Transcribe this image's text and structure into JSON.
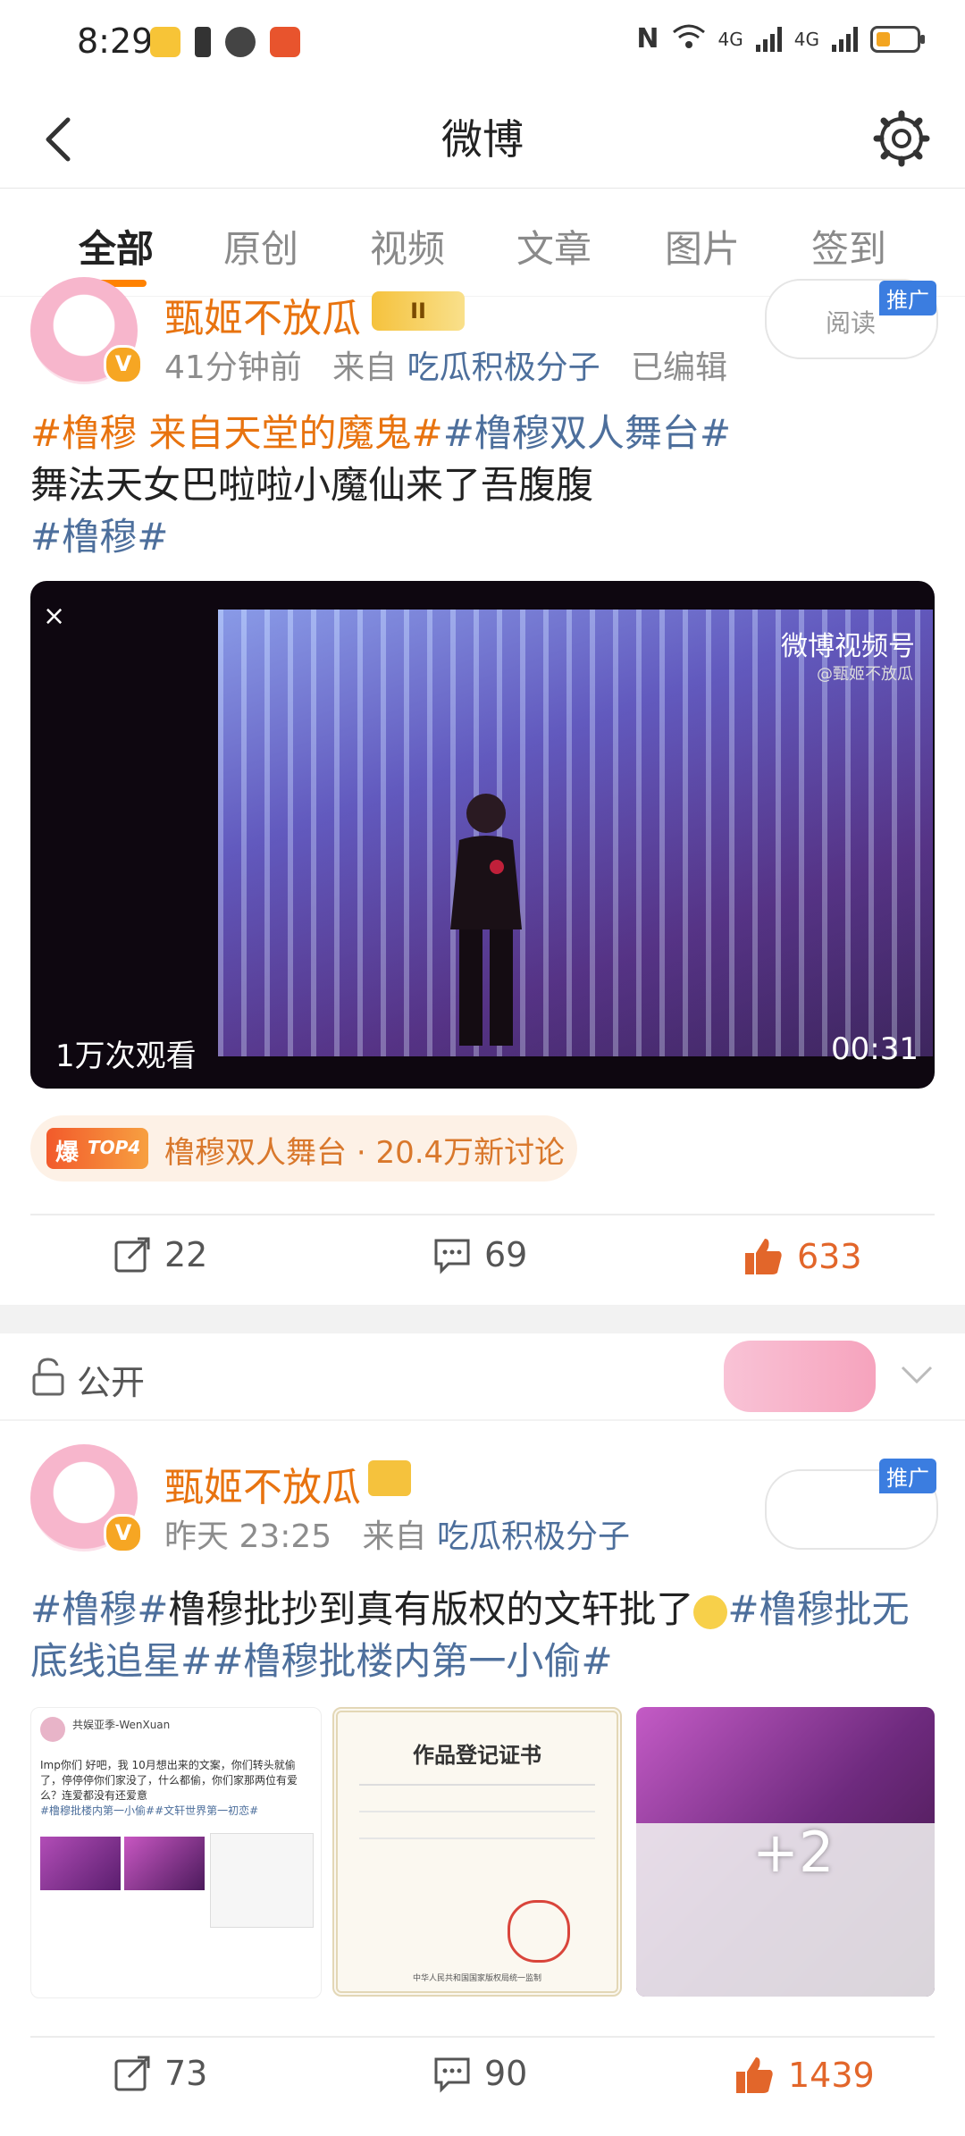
{
  "status_bar": {
    "time": "8:29",
    "network1": "4G",
    "network2": "4G",
    "battery_level": 0.35
  },
  "header": {
    "title": "微博"
  },
  "tabs": [
    {
      "label": "全部",
      "active": true
    },
    {
      "label": "原创"
    },
    {
      "label": "视频"
    },
    {
      "label": "文章"
    },
    {
      "label": "图片"
    },
    {
      "label": "签到"
    }
  ],
  "post1": {
    "username": "甄姬不放瓜",
    "level": "II",
    "time": "41分钟前",
    "from_prefix": "来自",
    "source": "吃瓜积极分子",
    "edited": "已编辑",
    "read_label": "阅读",
    "ad_label": "推广",
    "text_tag1": "#橹穆 来自天堂的魔鬼#",
    "text_tag2": "#橹穆双人舞台#",
    "text_body": "舞法天女巴啦啦小魔仙来了吾腹腹",
    "text_tag3": "#橹穆#",
    "video": {
      "close": "×",
      "watermark": "微博视频号",
      "watermark_sub": "@甄姬不放瓜",
      "views": "1万次观看",
      "duration": "00:31"
    },
    "topic": {
      "badge_main": "爆",
      "badge_rank": "TOP4",
      "name": "橹穆双人舞台",
      "separator": "·",
      "discussions": "20.4万新讨论"
    },
    "actions": {
      "repost": "22",
      "comment": "69",
      "like": "633"
    }
  },
  "visibility": {
    "label": "公开"
  },
  "post2": {
    "username": "甄姬不放瓜",
    "time": "昨天 23:25",
    "from_prefix": "来自",
    "source": "吃瓜积极分子",
    "ad_label": "推广",
    "text_tag1": "#橹穆#",
    "text_body": "橹穆批抄到真有版权的文轩批了",
    "text_tag2": "#橹穆批无底线追星#",
    "text_tag3": "#橹穆批楼内第一小偷#",
    "images": {
      "img1_user": "共娱亚季-WenXuan",
      "img1_text": "Imp你们 好吧，我 10月想出来的文案，你们转头就偷了，停停停你们家没了，什么都偷，你们家那两位有爱么？连爱都没有还爱意",
      "img1_tags": "#橹穆批楼内第一小偷##文轩世界第一初恋#",
      "img2_title": "作品登记证书",
      "img2_footer": "中华人民共和国国家版权局统一监制",
      "img3_more": "+2"
    },
    "actions": {
      "repost": "73",
      "comment": "90",
      "like": "1439"
    }
  },
  "colors": {
    "accent": "#ff8200",
    "username": "#e8730f",
    "link": "#4d6f9c",
    "like": "#e2662a"
  }
}
